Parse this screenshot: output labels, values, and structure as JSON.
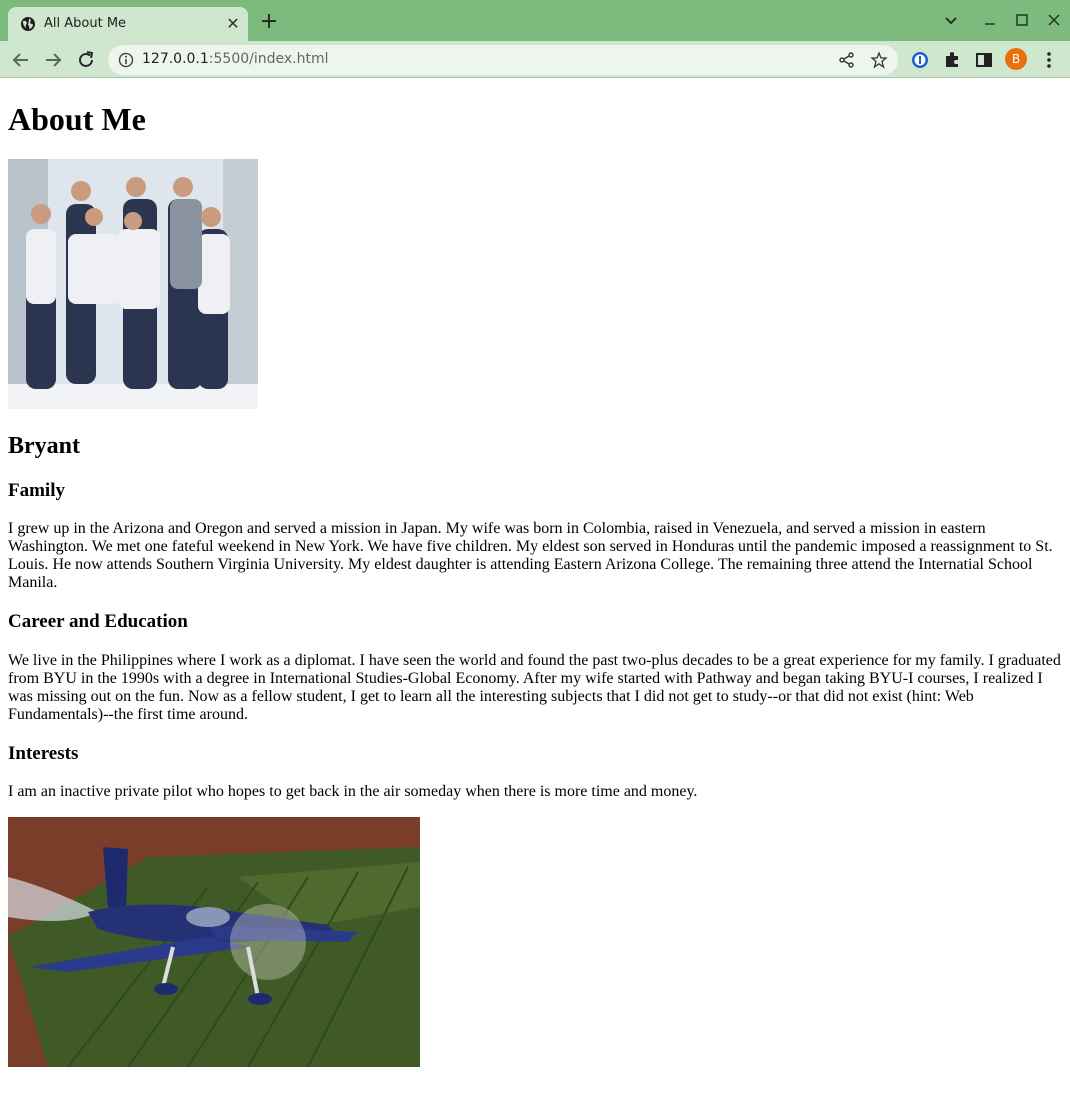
{
  "browser": {
    "tab_title": "All About Me",
    "url_host": "127.0.0.1",
    "url_rest": ":5500/index.html",
    "profile_initial": "B"
  },
  "page": {
    "heading": "About Me",
    "name": "Bryant",
    "family_heading": "Family",
    "family_text": "I grew up in the Arizona and Oregon and served a mission in Japan. My wife was born in Colombia, raised in Venezuela, and served a mission in eastern Washington. We met one fateful weekend in New York. We have five children. My eldest son served in Honduras until the pandemic imposed a reassignment to St. Louis. He now attends Southern Virginia University. My eldest daughter is attending Eastern Arizona College. The remaining three attend the Internatial School Manila.",
    "career_heading": "Career and Education",
    "career_text": "We live in the Philippines where I work as a diplomat. I have seen the world and found the past two-plus decades to be a great experience for my family. I graduated from BYU in the 1990s with a degree in International Studies-Global Economy. After my wife started with Pathway and began taking BYU-I courses, I realized I was missing out on the fun. Now as a fellow student, I get to learn all the interesting subjects that I did not get to study--or that did not exist (hint: Web Fundamentals)--the first time around.",
    "interests_heading": "Interests",
    "interests_text": "I am an inactive private pilot who hopes to get back in the air someday when there is more time and money."
  }
}
